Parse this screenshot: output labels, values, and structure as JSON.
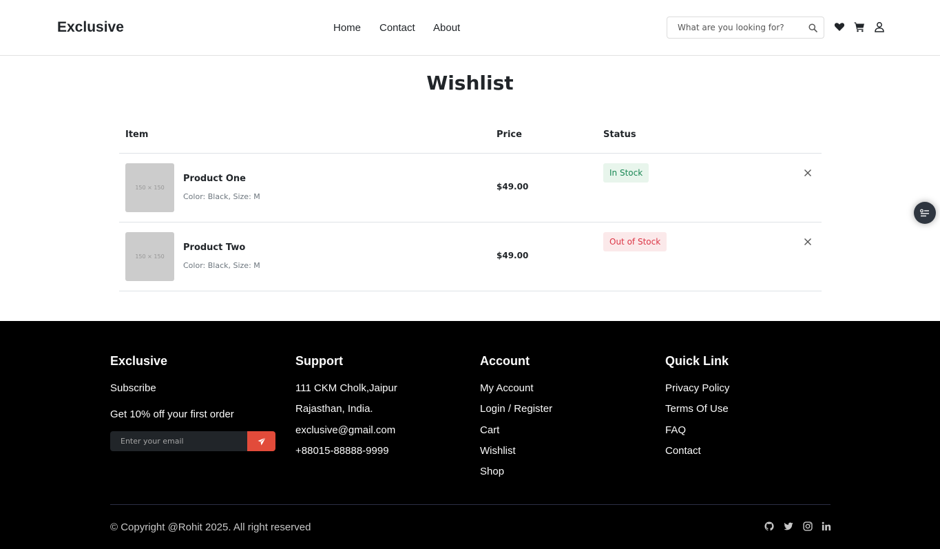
{
  "header": {
    "brand": "Exclusive",
    "nav": {
      "home": "Home",
      "contact": "Contact",
      "about": "About"
    },
    "search_placeholder": "What are you looking for?",
    "icons": [
      "search-icon",
      "heart-icon",
      "cart-icon",
      "user-icon"
    ]
  },
  "page": {
    "title": "Wishlist"
  },
  "table": {
    "headers": {
      "item": "Item",
      "price": "Price",
      "status": "Status"
    },
    "rows": [
      {
        "thumb": "150 × 150",
        "name": "Product One",
        "meta": "Color: Black, Size: M",
        "price": "$49.00",
        "status": "In Stock"
      },
      {
        "thumb": "150 × 150",
        "name": "Product Two",
        "meta": "Color: Black, Size: M",
        "price": "$49.00",
        "status": "Out of Stock"
      }
    ]
  },
  "footer": {
    "col1": {
      "title": "Exclusive",
      "subtitle": "Subscribe",
      "offer": "Get 10% off your first order",
      "email_placeholder": "Enter your email"
    },
    "col2": {
      "title": "Support",
      "lines": [
        "111 CKM Cholk,Jaipur",
        "Rajasthan, India.",
        "exclusive@gmail.com",
        "+88015-88888-9999"
      ]
    },
    "col3": {
      "title": "Account",
      "links": [
        "My Account",
        "Login / Register",
        "Cart",
        "Wishlist",
        "Shop"
      ]
    },
    "col4": {
      "title": "Quick Link",
      "links": [
        "Privacy Policy",
        "Terms Of Use",
        "FAQ",
        "Contact"
      ]
    },
    "copyright": "© Copyright @Rohit 2025. All right reserved",
    "social_icons": [
      "github-icon",
      "twitter-icon",
      "instagram-icon",
      "linkedin-icon"
    ]
  },
  "colors": {
    "footer_bg": "#000000",
    "accent_red": "#e24b3a",
    "in_stock_bg": "#e8f5ec",
    "in_stock_text": "#198754",
    "out_stock_bg": "#fbe9ea",
    "out_stock_text": "#dc3545"
  }
}
